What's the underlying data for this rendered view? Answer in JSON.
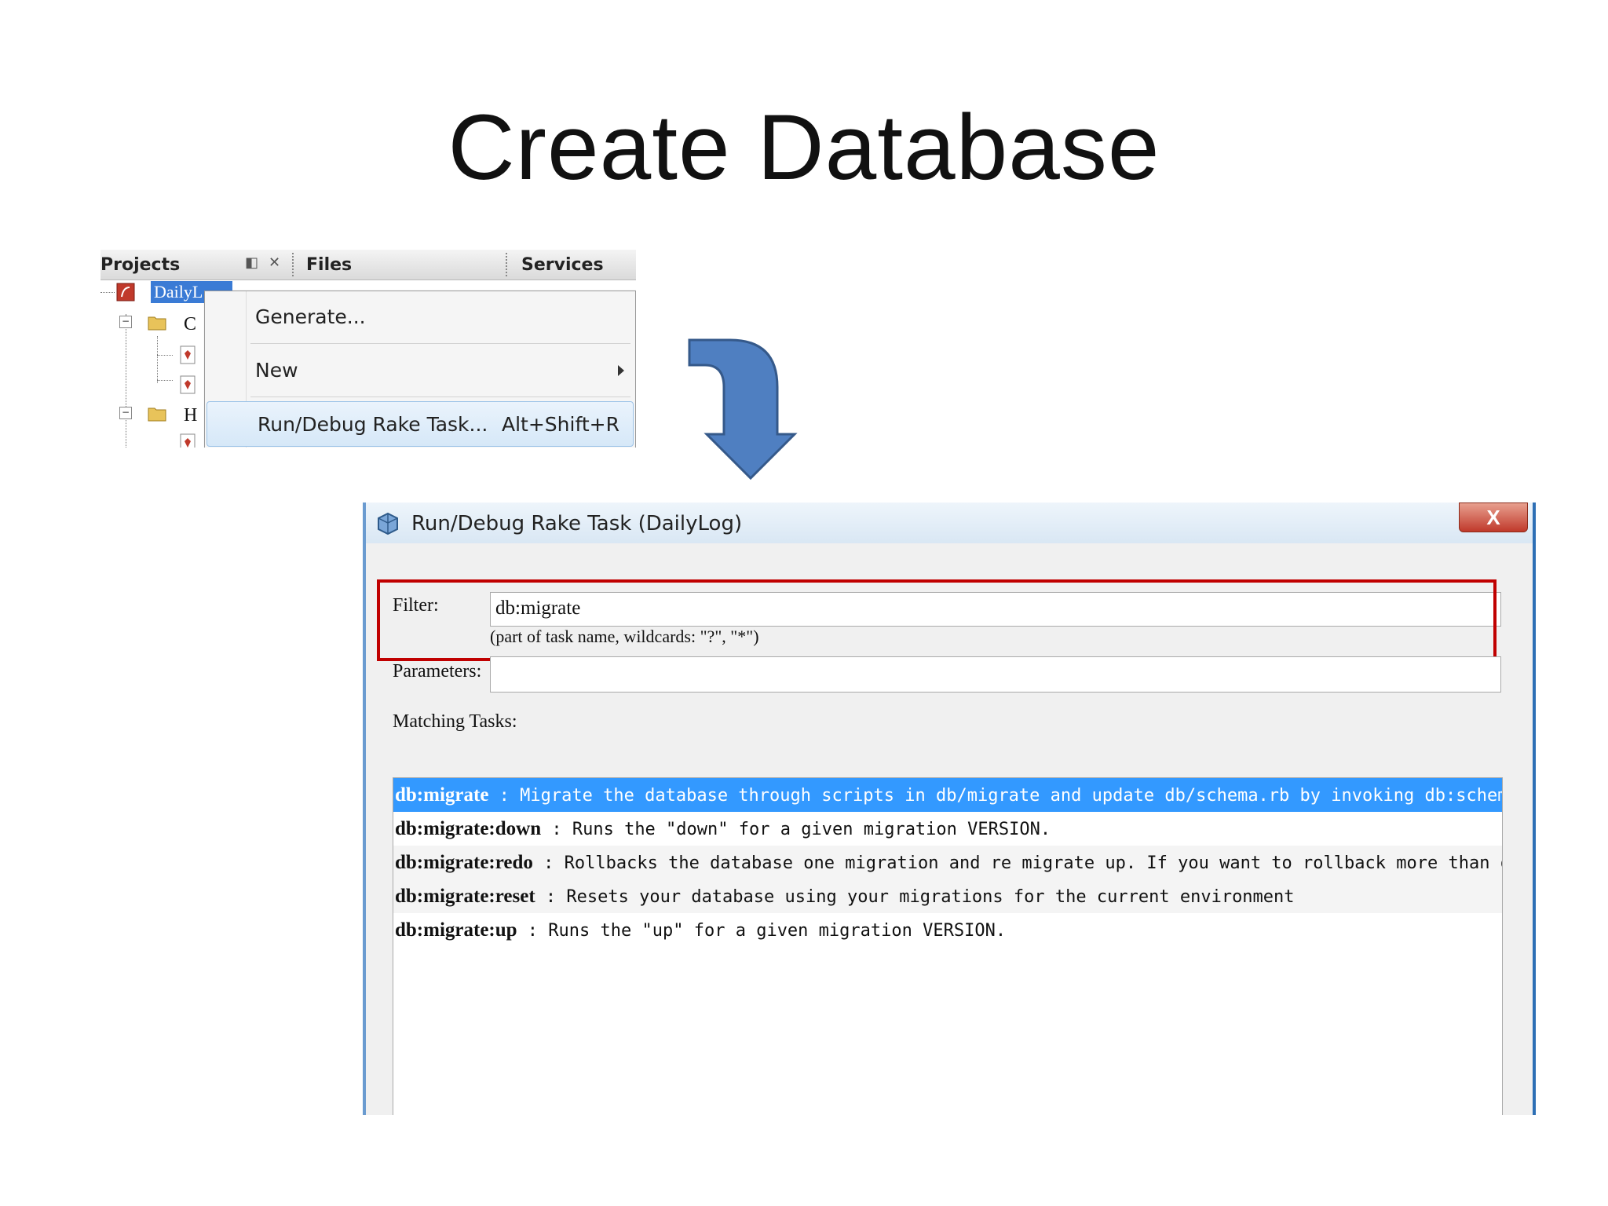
{
  "slide": {
    "title": "Create Database"
  },
  "ide": {
    "tabs": {
      "projects": "Projects",
      "files": "Files",
      "services": "Services"
    },
    "tree": {
      "root_label": "DailyL",
      "folder1_label": "C",
      "folder2_label": "H"
    },
    "context_menu": {
      "items": [
        {
          "label": "Generate..."
        },
        {
          "label": "New"
        },
        {
          "label": "Run/Debug Rake Task...",
          "shortcut": "Alt+Shift+R"
        }
      ]
    }
  },
  "dialog": {
    "title": "Run/Debug Rake Task (DailyLog)",
    "close_label": "X",
    "filter": {
      "label": "Filter:",
      "value": "db:migrate",
      "hint": "(part of task name, wildcards: \"?\", \"*\")"
    },
    "parameters": {
      "label": "Parameters:",
      "value": ""
    },
    "matching_tasks_label": "Matching Tasks:",
    "tasks": [
      {
        "name": "db:migrate",
        "desc": " : Migrate the database through scripts in db/migrate and update db/schema.rb by invoking db:schema:"
      },
      {
        "name": "db:migrate:down",
        "desc": " : Runs the \"down\" for a given migration VERSION."
      },
      {
        "name": "db:migrate:redo",
        "desc": " : Rollbacks the database one migration and re migrate up. If you want to rollback more than on"
      },
      {
        "name": "db:migrate:reset",
        "desc": " : Resets your database using your migrations for the current environment"
      },
      {
        "name": "db:migrate:up",
        "desc": " : Runs the \"up\" for a given migration VERSION."
      }
    ],
    "selected_task_index": 0
  },
  "colors": {
    "selection": "#3399ff",
    "highlight_box": "#c00000",
    "arrow": "#4f7fc1"
  }
}
